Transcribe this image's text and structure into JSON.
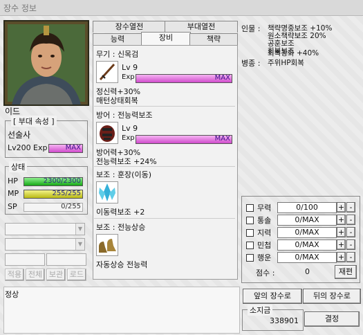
{
  "window": {
    "title": "장수 정보"
  },
  "hero": {
    "name": "이드",
    "unit_attr_title": "[ 부대 속성 ]",
    "unit_type": "선술사",
    "level_text": "Lv200",
    "exp_label": "Exp",
    "exp_text": "MAX",
    "status_title": "상태",
    "hp_label": "HP",
    "hp_text": "2300/2300",
    "hp_ratio": 1.0,
    "mp_label": "MP",
    "mp_text": "255/255",
    "mp_ratio": 1.0,
    "sp_label": "SP",
    "sp_text": "0/255",
    "sp_ratio": 0.0
  },
  "left_buttons": {
    "apply": "적용",
    "all": "전체",
    "keep": "보관",
    "load": "로드"
  },
  "tabs": {
    "top": [
      "장수열전",
      "부대열전"
    ],
    "bottom": [
      "능력",
      "장비",
      "책략"
    ],
    "active": "장비"
  },
  "equipment": {
    "weapon": {
      "header": "무기 :  신목검",
      "level": "Lv 9",
      "exp_label": "Exp",
      "exp_text": "MAX",
      "effects": [
        "정신력+30%",
        "매턴상태회복"
      ]
    },
    "armor": {
      "header": "방어 :  전능력보조",
      "level": "Lv 9",
      "exp_label": "Exp",
      "exp_text": "MAX",
      "effects": [
        "방어력+30%",
        "전능력보조 +24%"
      ]
    },
    "aux1": {
      "header": "보조 :  훈장(이동)",
      "effects": [
        "이동력보조 +2"
      ]
    },
    "aux2": {
      "header": "보조 :  전능상승",
      "effects": [
        "자동상승 전능력"
      ]
    }
  },
  "personality": {
    "label1": "인물 :",
    "lines1": [
      "책략명중보조 +10%",
      "원소책략보조 20%",
      "공훈보조",
      "회복보조",
      "회복강화 +40%"
    ],
    "label2": "병종 :",
    "lines2": [
      "주위HP회복"
    ]
  },
  "stats": {
    "rows": [
      {
        "name": "무력",
        "value": "0/100"
      },
      {
        "name": "통솔",
        "value": "0/MAX"
      },
      {
        "name": "지력",
        "value": "0/MAX"
      },
      {
        "name": "민첩",
        "value": "0/MAX"
      },
      {
        "name": "행운",
        "value": "0/MAX"
      }
    ],
    "plus": "+",
    "minus": "-",
    "score_label": "점수 :",
    "score_value": "0",
    "reassign": "재편"
  },
  "status_text": "정상",
  "nav": {
    "prev": "앞의 장수로",
    "next": "뒤의 장수로"
  },
  "gold": {
    "label": "소지금",
    "value": "338901",
    "confirm": "결정"
  },
  "colors": {
    "exp_bar": "#e27be0",
    "hp_bar": "#22cc22",
    "mp_bar": "#d8d82a",
    "sp_bar": "#cfcfcf",
    "max_text": "#3a0a8a",
    "bar_text": "#2a2a80"
  }
}
